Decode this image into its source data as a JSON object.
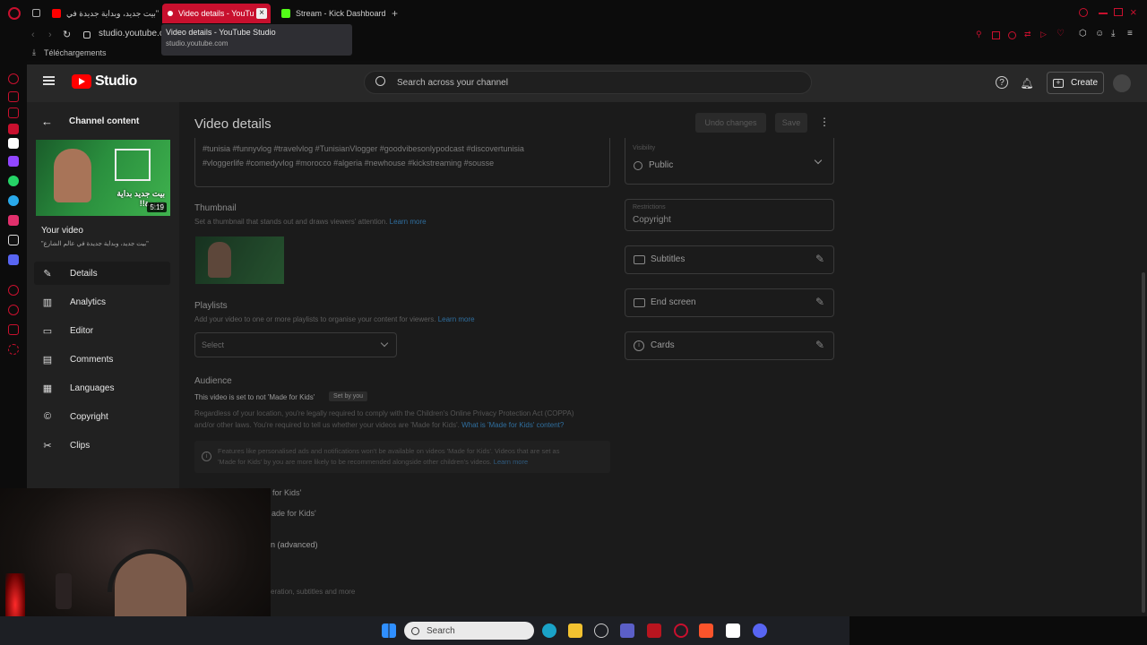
{
  "browser": {
    "tabs": [
      {
        "title": "\"بيت جديد، وبداية جديدة في",
        "active": false
      },
      {
        "title": "Video details - YouTu",
        "active": true
      },
      {
        "title": "Stream - Kick Dashboard",
        "active": false
      }
    ],
    "new_tab_symbol": "+",
    "url": "studio.youtube.c",
    "downloads_label": "Téléchargements",
    "tooltip": {
      "title": "Video details - YouTube Studio",
      "url": "studio.youtube.com"
    }
  },
  "header": {
    "logo_text": "Studio",
    "search_placeholder": "Search across your channel",
    "create_label": "Create"
  },
  "sidebar": {
    "back_label": "Channel content",
    "thumbnail_duration": "5:19",
    "thumbnail_text": "بيت جديد بداية جديدة!!",
    "your_video_label": "Your video",
    "video_title": "\"بيت جديد، وبداية جديدة في عالم الشارع\"",
    "items": [
      {
        "label": "Details",
        "icon": "pencil-icon",
        "selected": true
      },
      {
        "label": "Analytics",
        "icon": "analytics-icon",
        "selected": false
      },
      {
        "label": "Editor",
        "icon": "editor-icon",
        "selected": false
      },
      {
        "label": "Comments",
        "icon": "comments-icon",
        "selected": false
      },
      {
        "label": "Languages",
        "icon": "languages-icon",
        "selected": false
      },
      {
        "label": "Copyright",
        "icon": "copyright-icon",
        "selected": false
      },
      {
        "label": "Clips",
        "icon": "clips-icon",
        "selected": false
      }
    ]
  },
  "main": {
    "page_title": "Video details",
    "undo_label": "Undo changes",
    "save_label": "Save",
    "tags_line1": "#tunisia #funnyvlog #travelvlog #TunisianVlogger #goodvibesonlypodcast #discovertunisia",
    "tags_line2": "#vloggerlife #comedyvlog #morocco #algeria #newhouse #kickstreaming #sousse",
    "thumbnail_heading": "Thumbnail",
    "thumbnail_desc": "Set a thumbnail that stands out and draws viewers' attention.",
    "learn_more": "Learn more",
    "playlists_heading": "Playlists",
    "playlists_desc": "Add your video to one or more playlists to organise your content for viewers.",
    "playlist_select": "Select",
    "audience_heading": "Audience",
    "audience_status": "This video is set to not 'Made for Kids'",
    "set_by_you": "Set by you",
    "audience_desc1": "Regardless of your location, you're legally required to comply with the Children's Online Privacy Protection Act (COPPA)",
    "audience_desc2": "and/or other laws. You're required to tell us whether your videos are 'Made for Kids'.",
    "audience_link": "What is 'Made for Kids' content?",
    "info_line1": "Features like personalised ads and notifications won't be available on videos 'Made for Kids'. Videos that are set as",
    "info_line2": "'Made for Kids' by you are more likely to be recommended alongside other children's videos.",
    "option_yes_partial": "for Kids'",
    "option_no_partial": "ade for Kids'",
    "age_partial": "n (advanced)",
    "show_more_partial": "eration, subtitles and more"
  },
  "right": {
    "visibility_label": "Visibility",
    "visibility_value": "Public",
    "restrictions_label": "Restrictions",
    "restrictions_value": "Copyright",
    "subtitles": "Subtitles",
    "end_screen": "End screen",
    "cards": "Cards"
  },
  "taskbar": {
    "search_label": "Search"
  },
  "colors": {
    "youtube_red": "#ff0000",
    "opera_red": "#c8102e",
    "link_blue": "#3ea6ff",
    "kick_green": "#53fc18"
  }
}
